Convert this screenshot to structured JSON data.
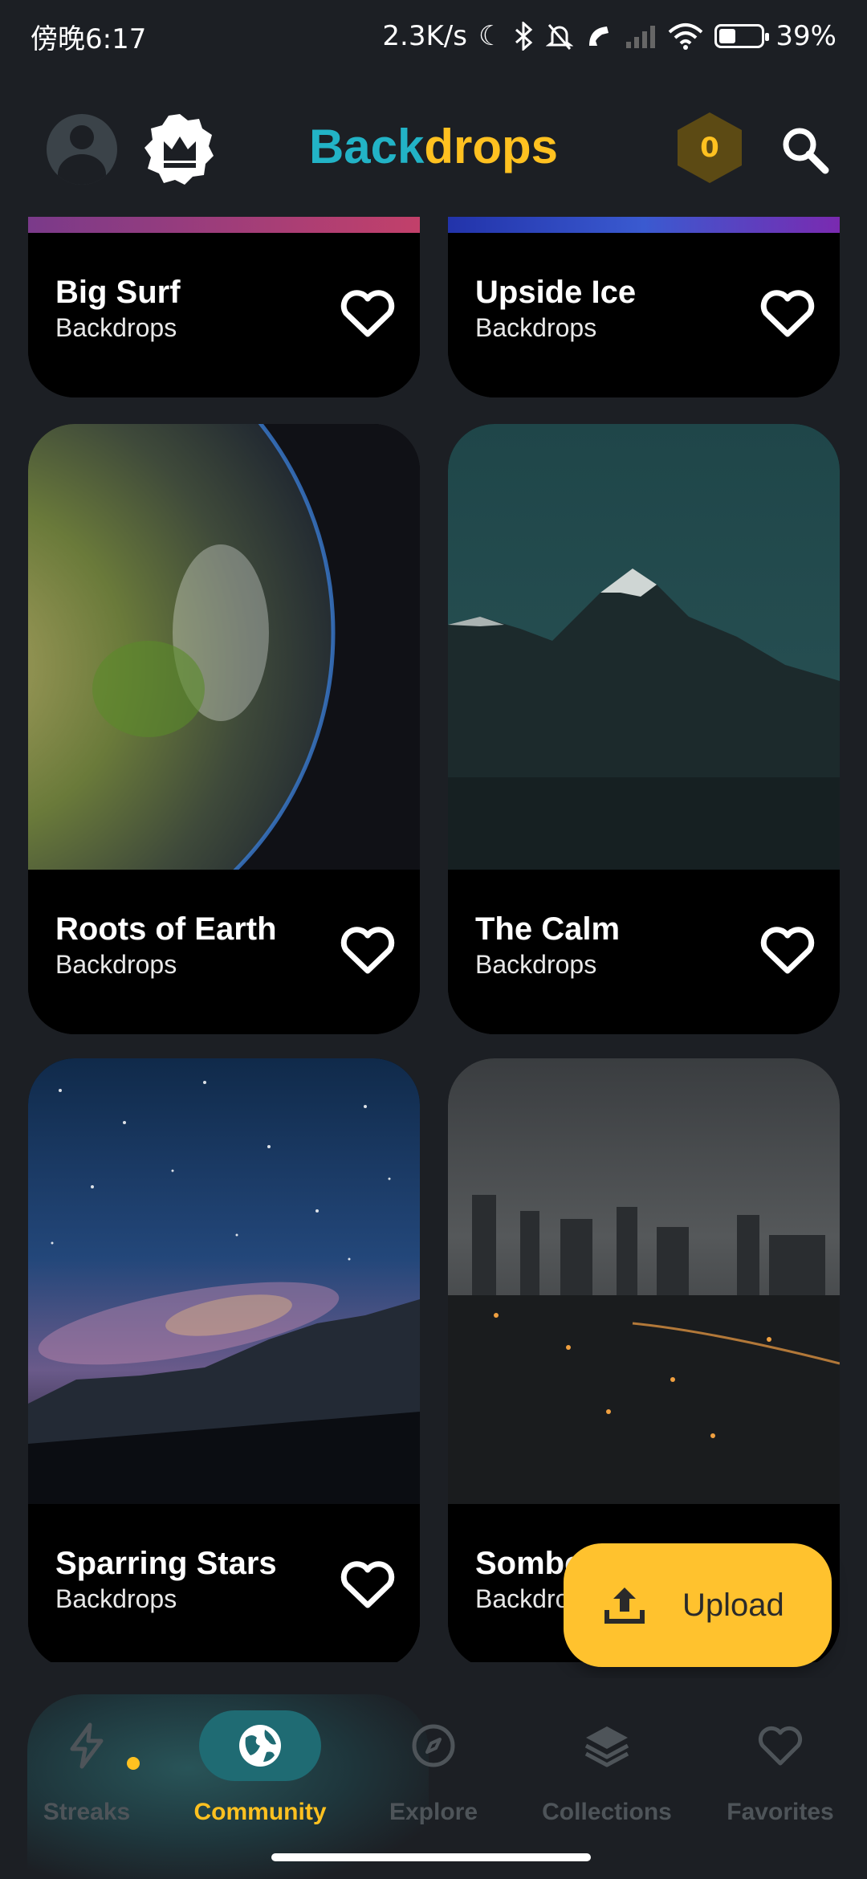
{
  "status_bar": {
    "time": "傍晚6:17",
    "network_speed": "2.3K/s",
    "battery_percent": "39%",
    "battery_level": 0.39,
    "icons": [
      "moon-icon",
      "bluetooth-icon",
      "mute-icon",
      "call-icon",
      "signal-icon",
      "wifi-icon",
      "battery-icon"
    ]
  },
  "app_bar": {
    "logo_part1": "Back",
    "logo_part2": "drops",
    "coin_count": "0",
    "colors": {
      "logo_blue": "#22b3c6",
      "logo_yellow": "#ffc120",
      "coin": "#ffc120"
    }
  },
  "cards": [
    {
      "title": "Big Surf",
      "subtitle": "Backdrops"
    },
    {
      "title": "Upside Ice",
      "subtitle": "Backdrops"
    },
    {
      "title": "Roots of Earth",
      "subtitle": "Backdrops"
    },
    {
      "title": "The Calm",
      "subtitle": "Backdrops"
    },
    {
      "title": "Sparring Stars",
      "subtitle": "Backdrops"
    },
    {
      "title": "Somber",
      "subtitle": "Backdrops"
    }
  ],
  "upload": {
    "label": "Upload"
  },
  "nav": {
    "items": [
      {
        "label": "Streaks",
        "icon": "lightning-icon"
      },
      {
        "label": "Community",
        "icon": "globe-icon",
        "active": true
      },
      {
        "label": "Explore",
        "icon": "compass-icon"
      },
      {
        "label": "Collections",
        "icon": "layers-icon"
      },
      {
        "label": "Favorites",
        "icon": "heart-icon"
      }
    ],
    "colors": {
      "active": "#ffc120",
      "inactive": "#4e5459",
      "active_pill": "#1f6b73"
    }
  }
}
